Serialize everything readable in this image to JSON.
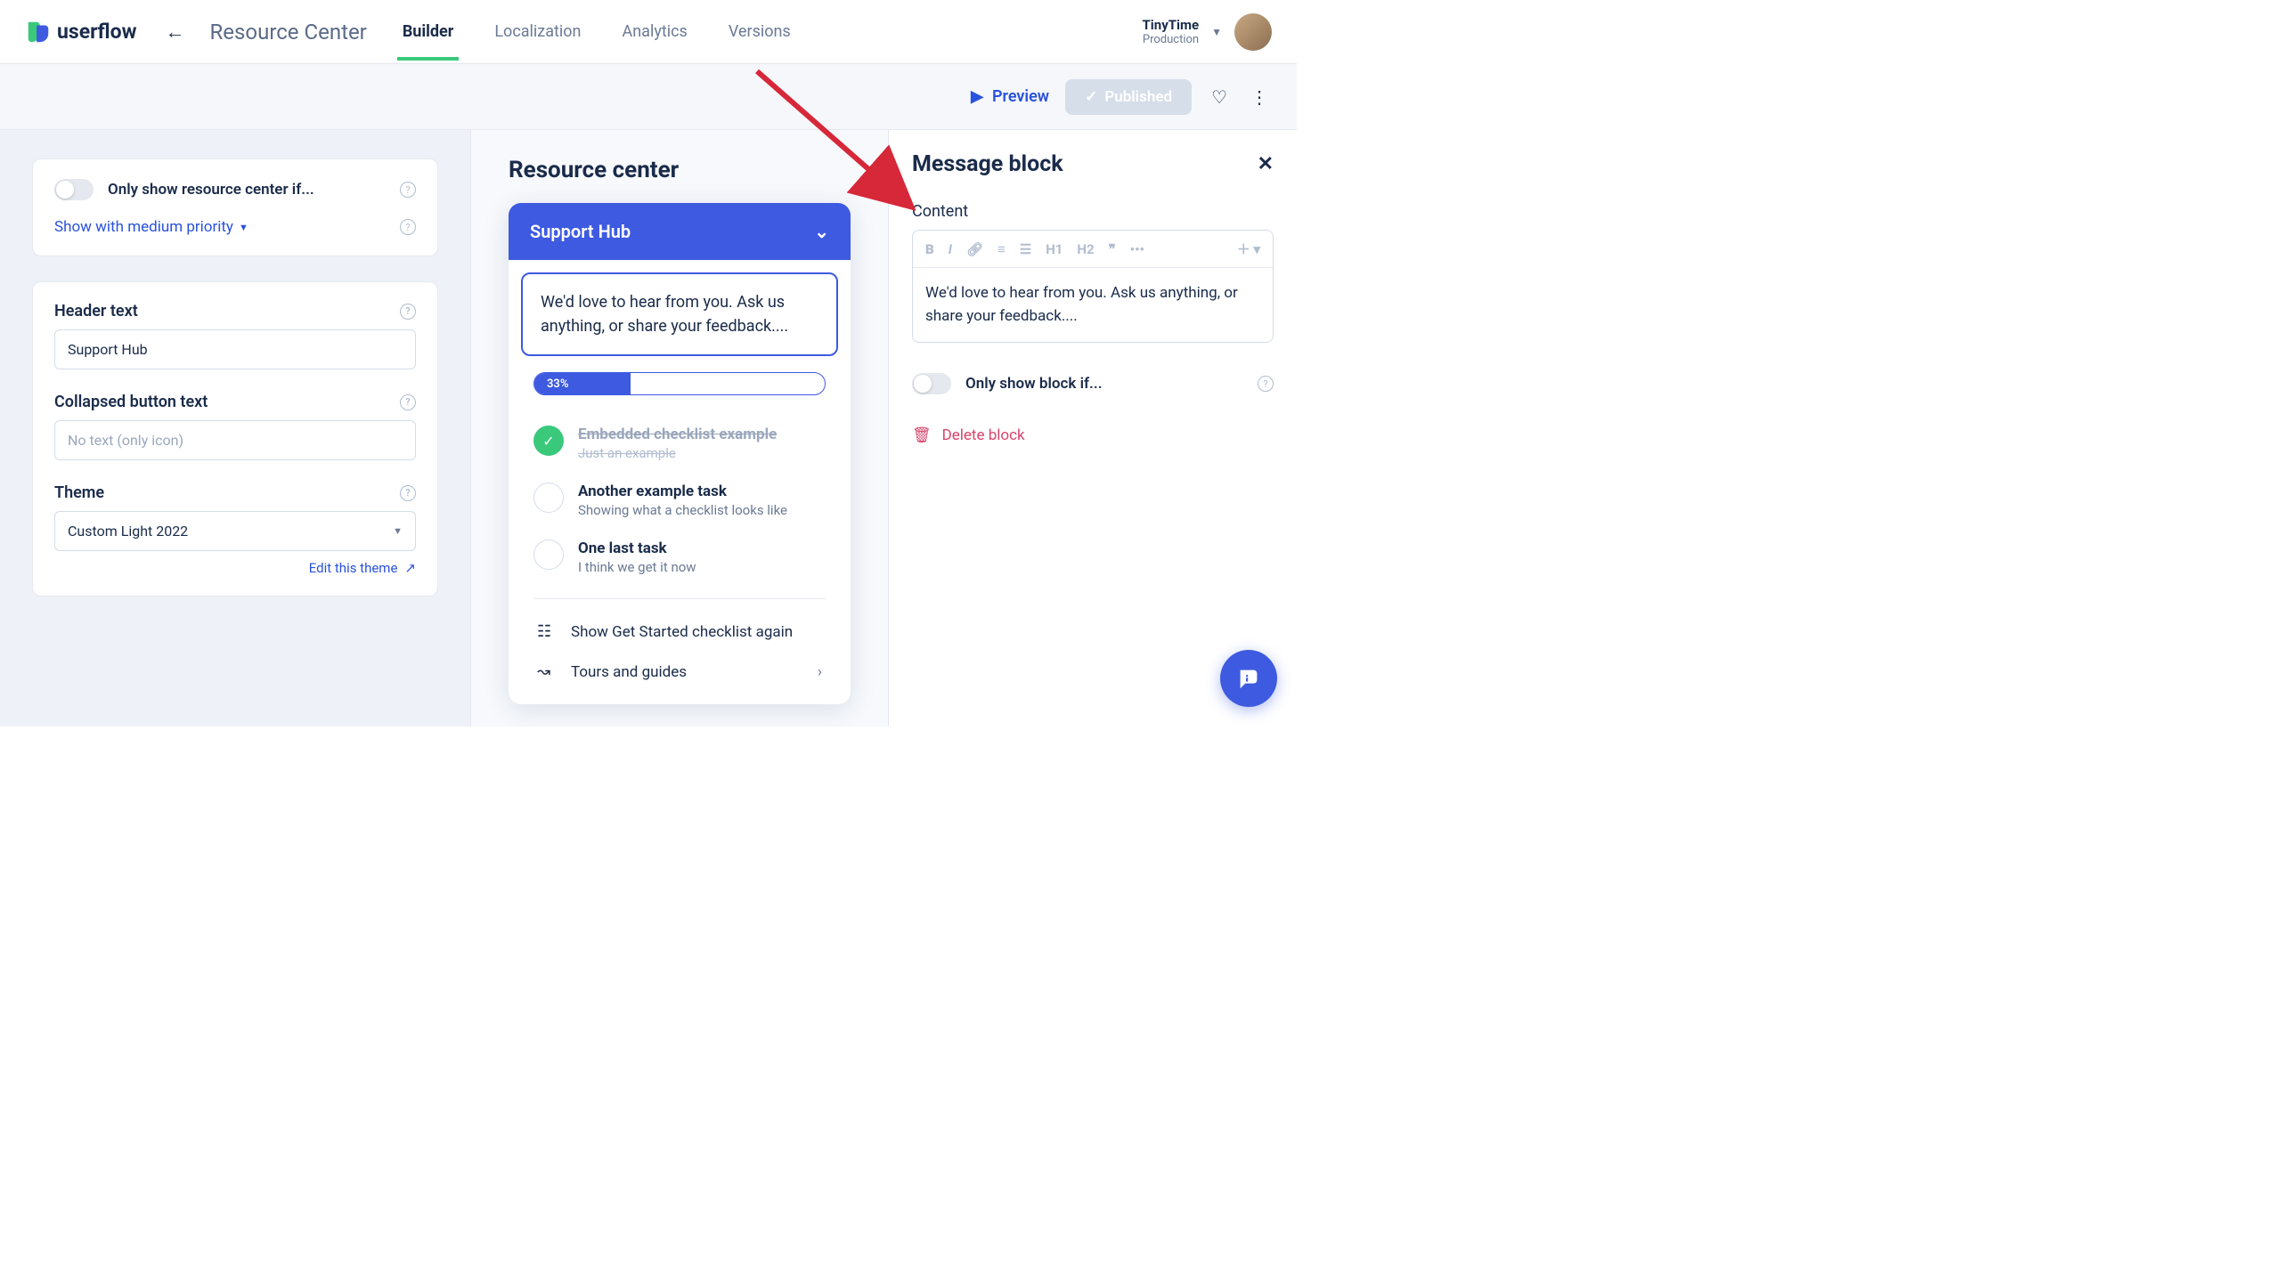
{
  "nav": {
    "brand": "userflow",
    "page_title": "Resource Center",
    "tabs": [
      "Builder",
      "Localization",
      "Analytics",
      "Versions"
    ],
    "active_tab": 0,
    "workspace_name": "TinyTime",
    "workspace_env": "Production"
  },
  "toolbar": {
    "preview": "Preview",
    "published": "Published"
  },
  "left": {
    "only_show_if": "Only show resource center if...",
    "priority": "Show with medium priority",
    "header_text_label": "Header text",
    "header_text_value": "Support Hub",
    "collapsed_label": "Collapsed button text",
    "collapsed_placeholder": "No text (only icon)",
    "theme_label": "Theme",
    "theme_value": "Custom Light 2022",
    "edit_theme": "Edit this theme"
  },
  "mid": {
    "title": "Resource center",
    "header": "Support Hub",
    "message": "We'd love to hear from you. Ask us anything, or share your feedback....",
    "progress_pct": 33,
    "progress_label": "33%",
    "checklist": [
      {
        "title": "Embedded checklist example",
        "sub": "Just an example",
        "done": true
      },
      {
        "title": "Another example task",
        "sub": "Showing what a checklist looks like",
        "done": false
      },
      {
        "title": "One last task",
        "sub": "I think we get it now",
        "done": false
      }
    ],
    "link_again": "Show Get Started checklist again",
    "link_tours": "Tours and guides"
  },
  "right": {
    "title": "Message block",
    "content_label": "Content",
    "toolbar": {
      "h1": "H1",
      "h2": "H2"
    },
    "content_text": "We'd love to hear from you. Ask us anything, or share your feedback....",
    "only_show_if": "Only show block if...",
    "delete": "Delete block"
  }
}
